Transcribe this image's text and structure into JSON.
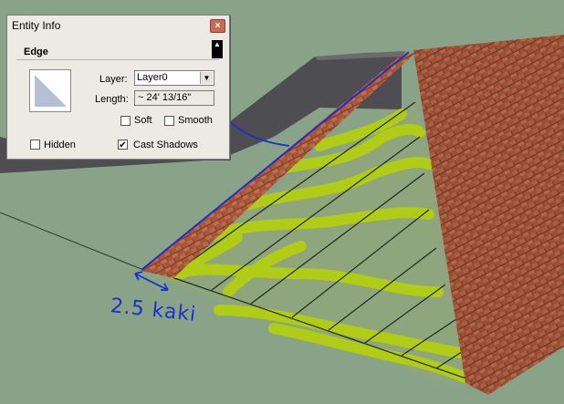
{
  "window": {
    "title": "Entity Info",
    "close_icon": "×",
    "entity_type": "Edge",
    "collapse_icon": "▲"
  },
  "fields": {
    "layer_label": "Layer:",
    "layer_value": "Layer0",
    "layer_dropdown_icon": "▼",
    "length_label": "Length:",
    "length_value": "~ 24' 13/16\""
  },
  "options": {
    "soft_label": "Soft",
    "soft_checked": false,
    "smooth_label": "Smooth",
    "smooth_checked": false,
    "hidden_label": "Hidden",
    "hidden_checked": false,
    "cast_shadows_label": "Cast Shadows",
    "cast_shadows_checked": true,
    "checkmark": "✔"
  },
  "annotation": {
    "text": "2.5 kaki"
  },
  "colors": {
    "ground": "#88a387",
    "wall": "#4d4d52",
    "roof_tile": "#a8583a",
    "rafter_paint": "#b4d10a",
    "highlight_edge": "#1e2fd0"
  }
}
